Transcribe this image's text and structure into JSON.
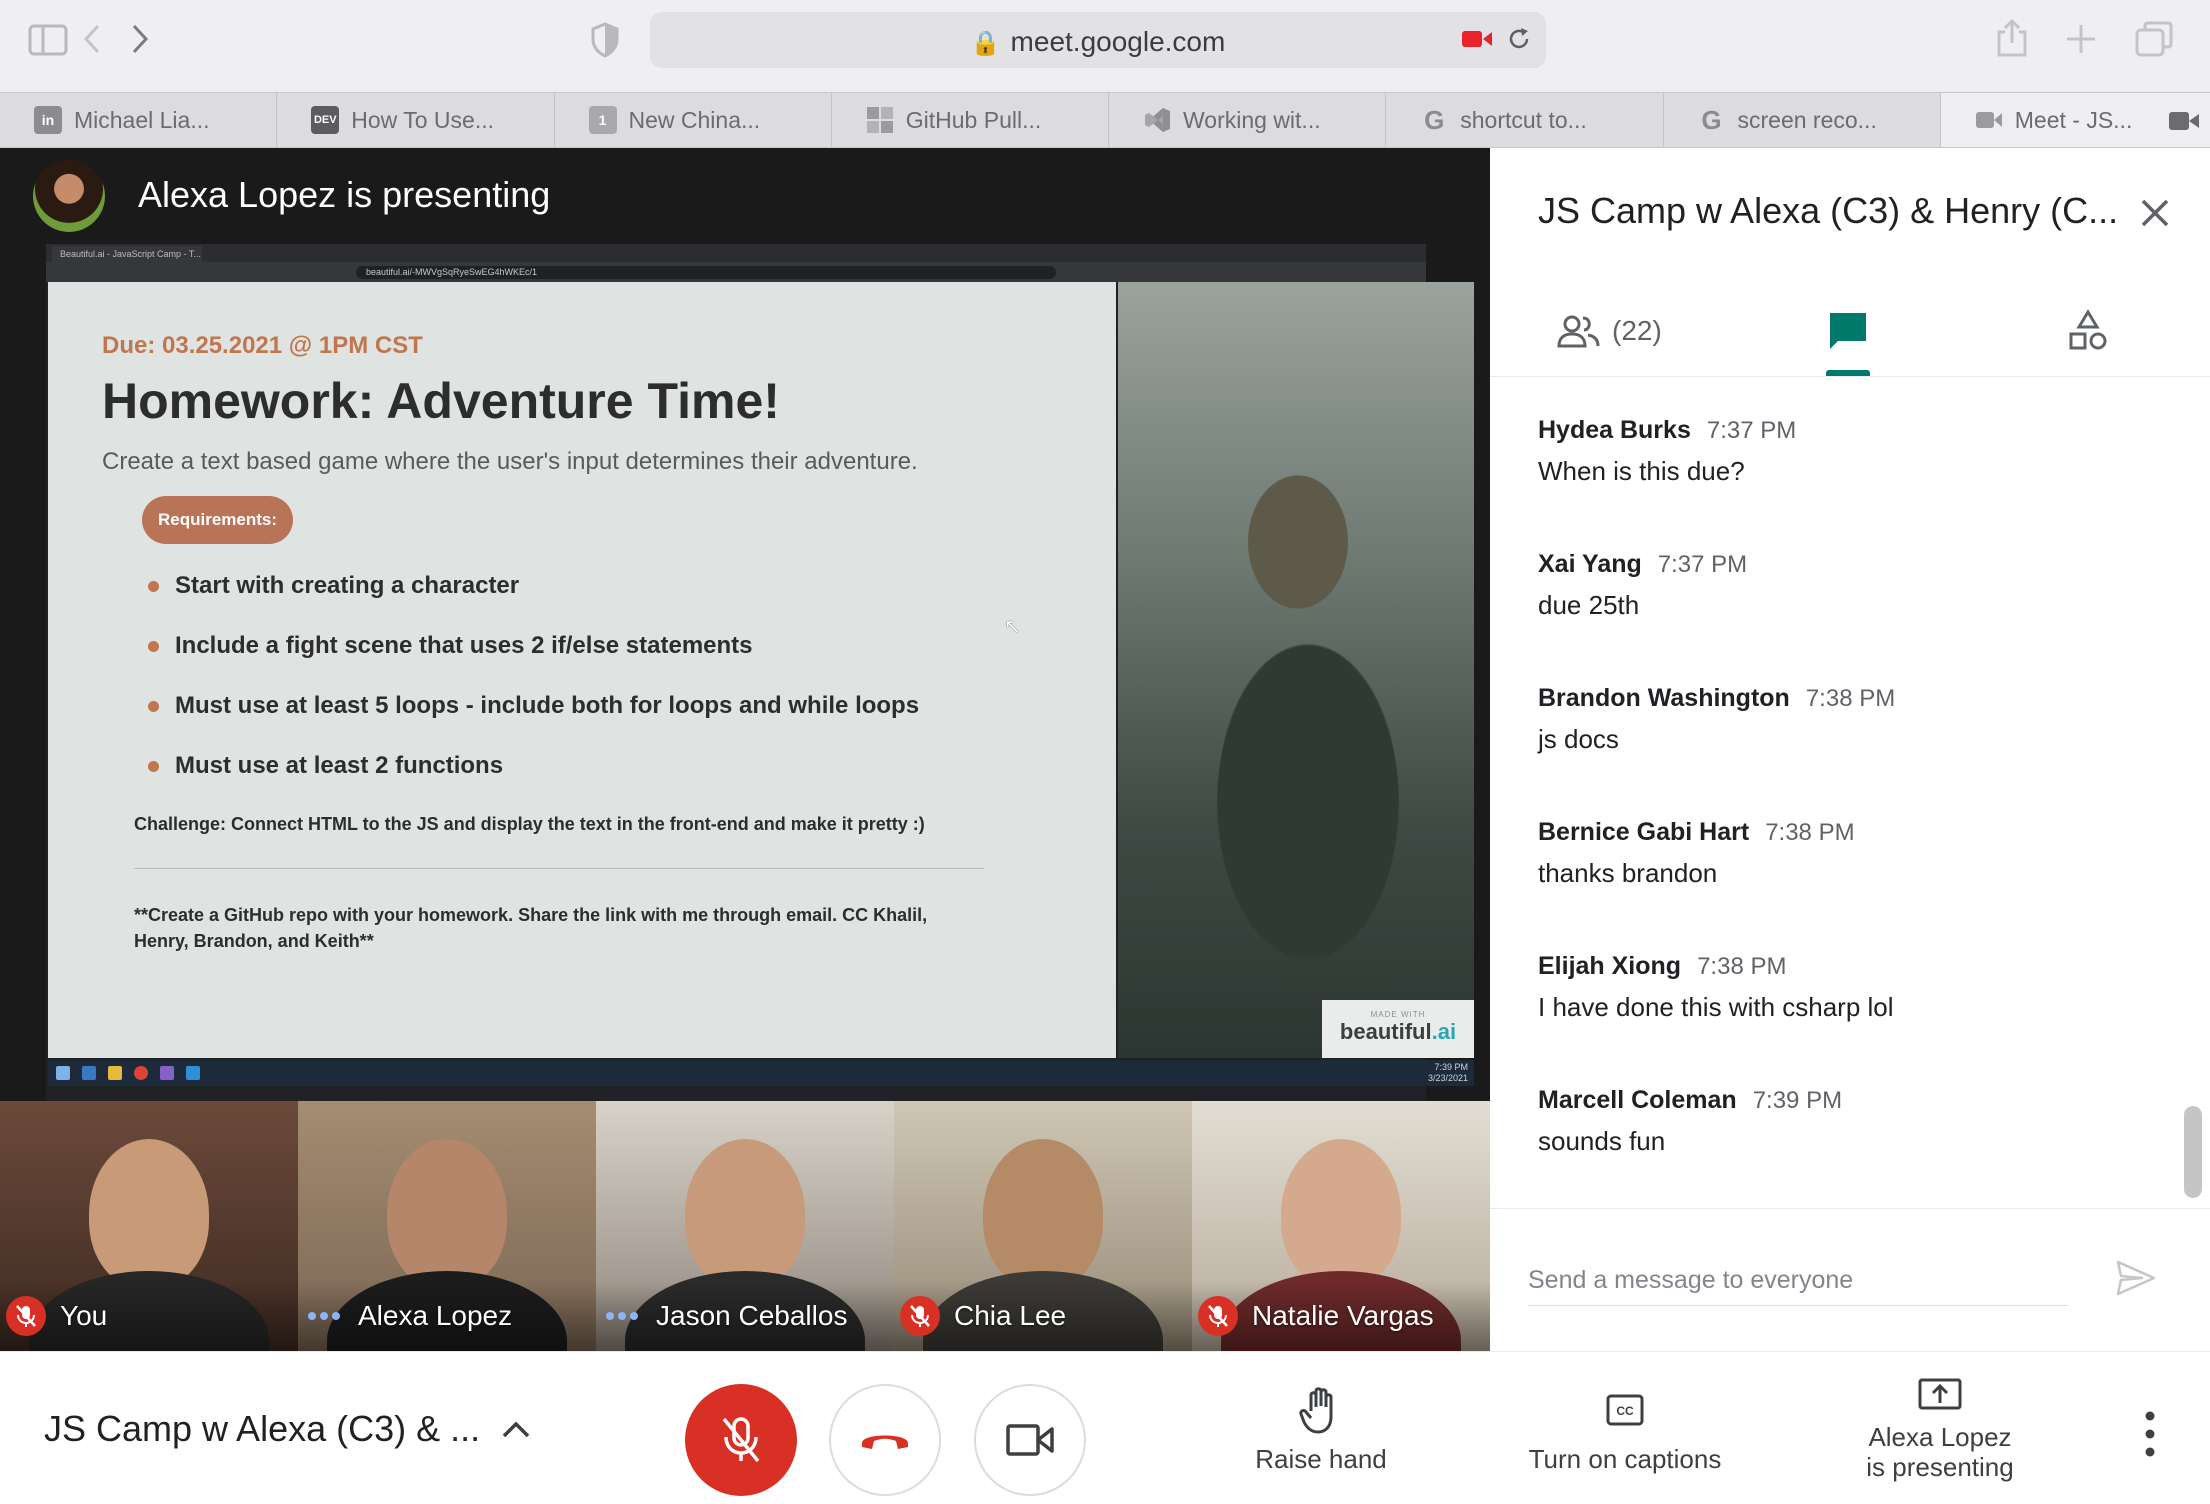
{
  "browser": {
    "url": "meet.google.com",
    "tabs": [
      {
        "label": "Michael Lia...",
        "favicon": "in"
      },
      {
        "label": "How To Use...",
        "favicon": "DEV"
      },
      {
        "label": "New China...",
        "favicon": "1"
      },
      {
        "label": "GitHub Pull...",
        "favicon": "grid"
      },
      {
        "label": "Working wit...",
        "favicon": "vscode"
      },
      {
        "label": "shortcut to...",
        "favicon": "G"
      },
      {
        "label": "screen reco...",
        "favicon": "G"
      },
      {
        "label": "Meet - JS...",
        "favicon": "meet"
      }
    ]
  },
  "stage": {
    "presenter_label": "Alexa Lopez is presenting",
    "mini_browser": {
      "tab": "Beautiful.ai - JavaScript Camp - T...",
      "url": "beautiful.ai/-MWVgSqRyeSwEG4hWKEc/1"
    },
    "slide": {
      "due": "Due: 03.25.2021 @ 1PM CST",
      "title": "Homework: Adventure Time!",
      "subtitle": "Create a text based game where the user's input determines their adventure.",
      "requirements_label": "Requirements:",
      "bullets": [
        "Start with creating a character",
        "Include a fight scene that uses 2 if/else statements",
        "Must use at least 5 loops - include both for loops and while loops",
        "Must use at least 2 functions"
      ],
      "challenge": "Challenge: Connect HTML to the JS and display the text in the front-end and make it pretty :)",
      "note": "**Create a GitHub repo with your homework. Share the link with me through email. CC Khalil, Henry, Brandon, and Keith**",
      "made_with_small": "MADE WITH",
      "made_with_brand_a": "beautiful",
      "made_with_brand_b": ".ai"
    },
    "taskbar_clock": {
      "time": "7:39 PM",
      "date": "3/23/2021"
    }
  },
  "participants": [
    {
      "name": "You",
      "muted": true
    },
    {
      "name": "Alexa Lopez",
      "muted": false
    },
    {
      "name": "Jason Ceballos",
      "muted": false
    },
    {
      "name": "Chia Lee",
      "muted": true
    },
    {
      "name": "Natalie Vargas",
      "muted": true
    }
  ],
  "panel": {
    "title": "JS Camp w Alexa (C3) & Henry (C...",
    "people_count": "(22)",
    "messages": [
      {
        "sender": "Hydea Burks",
        "time": "7:37 PM",
        "text": "When is this due?"
      },
      {
        "sender": "Xai Yang",
        "time": "7:37 PM",
        "text": "due 25th"
      },
      {
        "sender": "Brandon Washington",
        "time": "7:38 PM",
        "text": "js docs"
      },
      {
        "sender": "Bernice Gabi Hart",
        "time": "7:38 PM",
        "text": "thanks brandon"
      },
      {
        "sender": "Elijah Xiong",
        "time": "7:38 PM",
        "text": "I have done this with csharp lol"
      },
      {
        "sender": "Marcell Coleman",
        "time": "7:39 PM",
        "text": "sounds fun"
      }
    ],
    "compose_placeholder": "Send a message to everyone"
  },
  "bottom": {
    "meeting_name": "JS Camp w Alexa (C3) & ...",
    "raise_hand": "Raise hand",
    "captions": "Turn on captions",
    "presenting_line1": "Alexa Lopez",
    "presenting_line2": "is presenting"
  },
  "colors": {
    "meet_red": "#d93025",
    "meet_teal": "#00796b",
    "slide_accent": "#c0764f",
    "slide_bg": "#dfe4e2"
  }
}
